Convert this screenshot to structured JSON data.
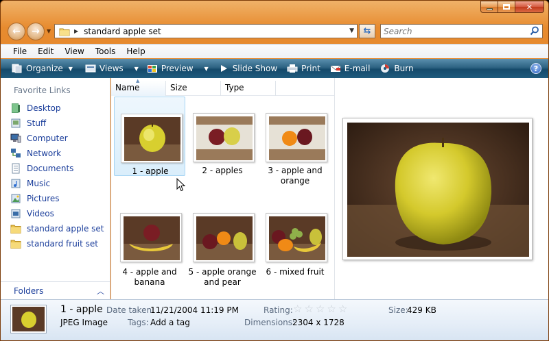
{
  "window": {
    "address": {
      "crumb": "standard apple set"
    },
    "search": {
      "placeholder": "Search"
    }
  },
  "menu": [
    "File",
    "Edit",
    "View",
    "Tools",
    "Help"
  ],
  "toolbar": {
    "organize": "Organize",
    "views": "Views",
    "preview": "Preview",
    "slideshow": "Slide Show",
    "print": "Print",
    "email": "E-mail",
    "burn": "Burn",
    "help": "?"
  },
  "nav": {
    "header": "Favorite Links",
    "links": [
      {
        "label": "Desktop",
        "icon": "desktop-icon"
      },
      {
        "label": "Stuff",
        "icon": "stuff-icon"
      },
      {
        "label": "Computer",
        "icon": "computer-icon"
      },
      {
        "label": "Network",
        "icon": "network-icon"
      },
      {
        "label": "Documents",
        "icon": "documents-icon"
      },
      {
        "label": "Music",
        "icon": "music-icon"
      },
      {
        "label": "Pictures",
        "icon": "pictures-icon"
      },
      {
        "label": "Videos",
        "icon": "videos-icon"
      },
      {
        "label": "standard apple set",
        "icon": "folder-icon"
      },
      {
        "label": "standard fruit set",
        "icon": "folder-icon"
      }
    ],
    "folders_label": "Folders"
  },
  "columns": [
    "Name",
    "Size",
    "Type"
  ],
  "files": [
    {
      "line1": "1 - apple",
      "line2": "",
      "selected": true
    },
    {
      "line1": "2 - apples",
      "line2": "",
      "selected": false
    },
    {
      "line1": "3 - apple and",
      "line2": "orange",
      "selected": false
    },
    {
      "line1": "4 - apple and",
      "line2": "banana",
      "selected": false
    },
    {
      "line1": "5 - apple orange",
      "line2": "and pear",
      "selected": false
    },
    {
      "line1": "6 - mixed fruit",
      "line2": "",
      "selected": false
    }
  ],
  "details": {
    "name": "1 - apple",
    "type": "JPEG Image",
    "date_taken_label": "Date taken:",
    "date_taken": "11/21/2004 11:19 PM",
    "tags_label": "Tags:",
    "tags": "Add a tag",
    "rating_label": "Rating:",
    "rating_value": 0,
    "rating_max": 5,
    "dimensions_label": "Dimensions:",
    "dimensions": "2304 x 1728",
    "size_label": "Size:",
    "size": "429 KB"
  },
  "colors": {
    "frame": "#e07a1f",
    "command_bar": "#1f5b7d",
    "link": "#1b3e9b",
    "selection": "#daeefb"
  }
}
